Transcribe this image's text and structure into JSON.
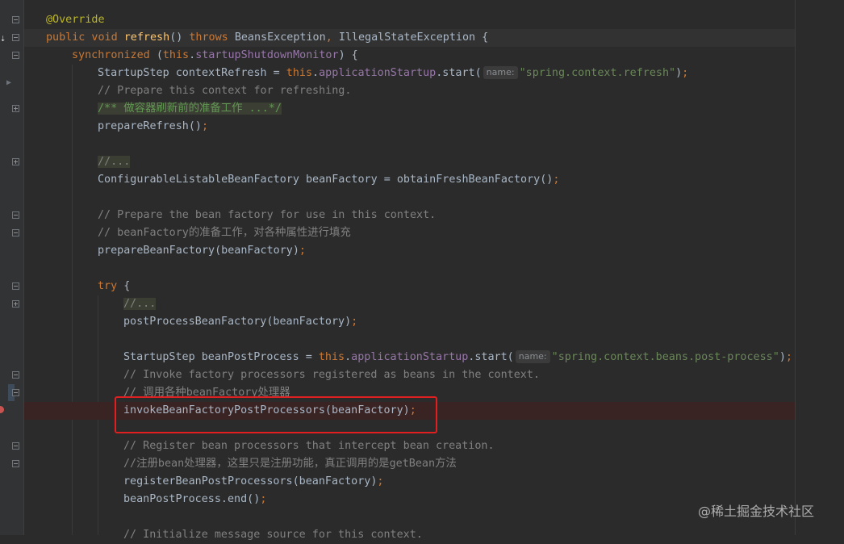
{
  "editor": {
    "lines": [
      {
        "id": "l1",
        "parts": [
          [
            "ann",
            "@Override"
          ]
        ]
      },
      {
        "id": "l2",
        "parts": [
          [
            "kw",
            "public void "
          ],
          [
            "fn",
            "refresh"
          ],
          [
            "",
            "() "
          ],
          [
            "kw",
            "throws "
          ],
          [
            "",
            "BeansException"
          ],
          [
            "punc",
            ", "
          ],
          [
            "",
            "IllegalStateException {"
          ]
        ]
      },
      {
        "id": "l3",
        "parts": [
          [
            "kw",
            "synchronized "
          ],
          [
            "",
            "("
          ],
          [
            "kw",
            "this"
          ],
          [
            "",
            "."
          ],
          [
            "field",
            "startupShutdownMonitor"
          ],
          [
            "",
            ") {"
          ]
        ]
      },
      {
        "id": "l4",
        "parts": [
          [
            "",
            "StartupStep contextRefresh = "
          ],
          [
            "kw",
            "this"
          ],
          [
            "",
            "."
          ],
          [
            "field",
            "applicationStartup"
          ],
          [
            "",
            ".start("
          ],
          [
            "hint",
            "name:"
          ],
          [
            "str",
            "\"spring.context.refresh\""
          ],
          [
            "",
            ")"
          ],
          [
            "punc",
            ";"
          ]
        ]
      },
      {
        "id": "l5",
        "parts": [
          [
            "cmt",
            "// Prepare this context for refreshing."
          ]
        ]
      },
      {
        "id": "l6",
        "parts": [
          [
            "doc-fold",
            "/** 做容器刷新前的准备工作 ...*/"
          ]
        ]
      },
      {
        "id": "l7",
        "parts": [
          [
            "",
            "prepareRefresh()"
          ],
          [
            "punc",
            ";"
          ]
        ]
      },
      {
        "id": "l8",
        "parts": []
      },
      {
        "id": "l9",
        "parts": [
          [
            "fold-cmt",
            "//..."
          ]
        ]
      },
      {
        "id": "l10",
        "parts": [
          [
            "",
            "ConfigurableListableBeanFactory beanFactory = obtainFreshBeanFactory()"
          ],
          [
            "punc",
            ";"
          ]
        ]
      },
      {
        "id": "l11",
        "parts": []
      },
      {
        "id": "l12",
        "parts": [
          [
            "cmt",
            "// Prepare the bean factory for use in this context."
          ]
        ]
      },
      {
        "id": "l13",
        "parts": [
          [
            "cmt",
            "// beanFactory的准备工作，对各种属性进行填充"
          ]
        ]
      },
      {
        "id": "l14",
        "parts": [
          [
            "",
            "prepareBeanFactory(beanFactory)"
          ],
          [
            "punc",
            ";"
          ]
        ]
      },
      {
        "id": "l15",
        "parts": []
      },
      {
        "id": "l16",
        "parts": [
          [
            "kw",
            "try "
          ],
          [
            "",
            "{"
          ]
        ]
      },
      {
        "id": "l17",
        "parts": [
          [
            "fold-cmt",
            "//..."
          ]
        ]
      },
      {
        "id": "l18",
        "parts": [
          [
            "",
            "postProcessBeanFactory(beanFactory)"
          ],
          [
            "punc",
            ";"
          ]
        ]
      },
      {
        "id": "l19",
        "parts": []
      },
      {
        "id": "l20",
        "parts": [
          [
            "",
            "StartupStep beanPostProcess = "
          ],
          [
            "kw",
            "this"
          ],
          [
            "",
            "."
          ],
          [
            "field",
            "applicationStartup"
          ],
          [
            "",
            ".start("
          ],
          [
            "hint",
            "name:"
          ],
          [
            "str",
            "\"spring.context.beans.post-process\""
          ],
          [
            "",
            ")"
          ],
          [
            "punc",
            ";"
          ]
        ]
      },
      {
        "id": "l21",
        "parts": [
          [
            "cmt",
            "// Invoke factory processors registered as beans in the context."
          ]
        ]
      },
      {
        "id": "l22",
        "parts": [
          [
            "cmt",
            "// 调用各种beanFactory处理器"
          ]
        ]
      },
      {
        "id": "l23",
        "parts": [
          [
            "",
            "invokeBeanFactoryPostProcessors(beanFactory)"
          ],
          [
            "punc",
            ";"
          ]
        ]
      },
      {
        "id": "l24",
        "parts": []
      },
      {
        "id": "l25",
        "parts": [
          [
            "cmt",
            "// Register bean processors that intercept bean creation."
          ]
        ]
      },
      {
        "id": "l26",
        "parts": [
          [
            "cmt",
            "//注册bean处理器，这里只是注册功能，真正调用的是getBean方法"
          ]
        ]
      },
      {
        "id": "l27",
        "parts": [
          [
            "",
            "registerBeanPostProcessors(beanFactory)"
          ],
          [
            "punc",
            ";"
          ]
        ]
      },
      {
        "id": "l28",
        "parts": [
          [
            "",
            "beanPostProcess.end()"
          ],
          [
            "punc",
            ";"
          ]
        ]
      },
      {
        "id": "l29",
        "parts": []
      },
      {
        "id": "l30",
        "parts": [
          [
            "cmt",
            "// Initialize message source for this context."
          ]
        ]
      }
    ]
  },
  "watermark": "@稀土掘金技术社区",
  "colors": {
    "background": "#2b2b2b",
    "keyword": "#cc7832",
    "method_decl": "#ffc66d",
    "field": "#9876aa",
    "string": "#6a8759",
    "comment": "#808080",
    "annotation": "#bbb529",
    "highlight_box": "#e02020",
    "breakpoint": "#c75450"
  }
}
